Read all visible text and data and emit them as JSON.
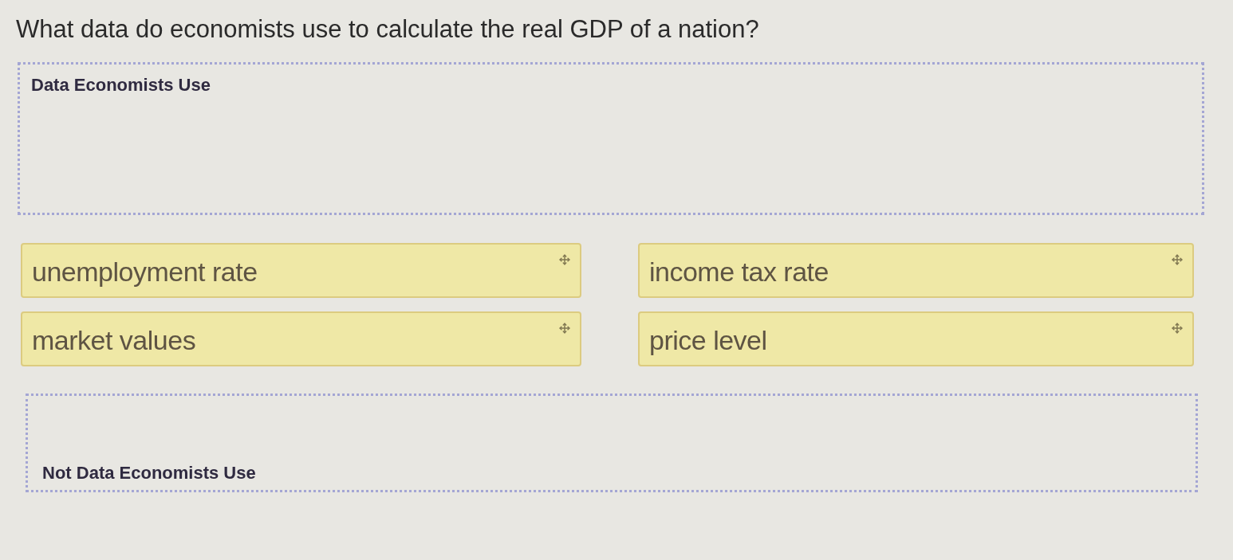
{
  "question": "What data do economists use to calculate the real GDP of a nation?",
  "drop_zones": [
    {
      "kind": "heading_top",
      "heading": "Data Economists Use"
    },
    {
      "kind": "heading_bottom",
      "heading": "Not Data Economists Use"
    }
  ],
  "cards": [
    {
      "label": "unemployment rate"
    },
    {
      "label": "income tax rate"
    },
    {
      "label": "market values"
    },
    {
      "label": "price level"
    }
  ]
}
